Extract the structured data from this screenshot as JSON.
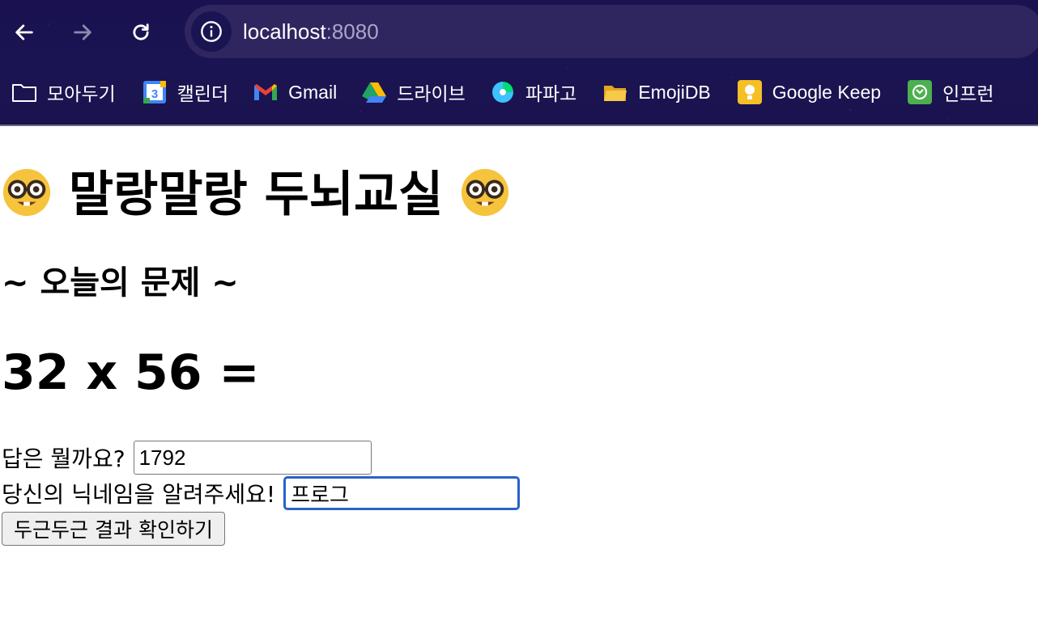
{
  "browser": {
    "url_host": "localhost",
    "url_port": ":8080",
    "bookmarks": [
      {
        "label": "모아두기",
        "icon": "folder-icon"
      },
      {
        "label": "캘린더",
        "icon": "google-calendar-icon"
      },
      {
        "label": "Gmail",
        "icon": "gmail-icon"
      },
      {
        "label": "드라이브",
        "icon": "google-drive-icon"
      },
      {
        "label": "파파고",
        "icon": "papago-icon"
      },
      {
        "label": "EmojiDB",
        "icon": "folder-icon"
      },
      {
        "label": "Google Keep",
        "icon": "google-keep-icon"
      },
      {
        "label": "인프런",
        "icon": "inflearn-icon"
      }
    ],
    "colors": {
      "chrome_bg": "#1b1452",
      "omnibox_bg": "#2f2660"
    }
  },
  "page": {
    "title": "말랑말랑 두뇌교실",
    "subtitle": "~ 오늘의 문제 ~",
    "problem": "32 x 56 =",
    "answer_label": "답은 뭘까요?",
    "answer_value": "1792",
    "nickname_label": "당신의 닉네임을 알려주세요!",
    "nickname_value": "프로그",
    "submit_label": "두근두근 결과 확인하기",
    "colors": {
      "focus_border": "#2a62c8"
    }
  }
}
